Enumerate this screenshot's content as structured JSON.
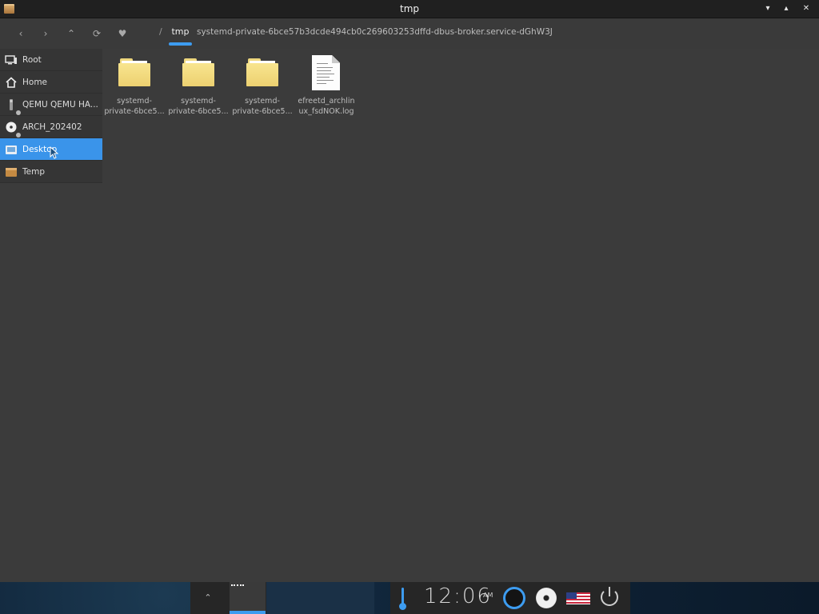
{
  "window": {
    "title": "tmp",
    "controls": [
      "▾",
      "▴",
      "✕"
    ]
  },
  "toolbar": {
    "back_icon": "‹",
    "forward_icon": "›",
    "up_icon": "⌃",
    "refresh_icon": "⟳",
    "bookmark_icon": "♥",
    "breadcrumb_root": "/",
    "breadcrumb_current": "tmp",
    "breadcrumb_path": "systemd-private-6bce57b3dcde494cb0c269603253dffd-dbus-broker.service-dGhW3J"
  },
  "sidebar": {
    "items": [
      {
        "label": "Root",
        "icon": "monitor-icon"
      },
      {
        "label": "Home",
        "icon": "home-icon"
      },
      {
        "label": "QEMU QEMU HA...",
        "icon": "usb-drive-icon"
      },
      {
        "label": "ARCH_202402",
        "icon": "optical-disc-icon"
      },
      {
        "label": "Desktop",
        "icon": "desktop-folder-icon",
        "active": true
      },
      {
        "label": "Temp",
        "icon": "temp-folder-icon"
      }
    ]
  },
  "files": [
    {
      "name": "systemd-\nprivate-6bce5...",
      "type": "folder"
    },
    {
      "name": "systemd-\nprivate-6bce5...",
      "type": "folder"
    },
    {
      "name": "systemd-\nprivate-6bce5...",
      "type": "folder"
    },
    {
      "name": "efreetd_archlin\nux_fsdNOK.log",
      "type": "document"
    }
  ],
  "taskbar": {
    "expand_icon": "⌃",
    "clock": "12:06",
    "ampm": "AM"
  },
  "colors": {
    "accent": "#3a94ea",
    "background": "#3b3b3b",
    "folder": "#f3dc7f"
  }
}
